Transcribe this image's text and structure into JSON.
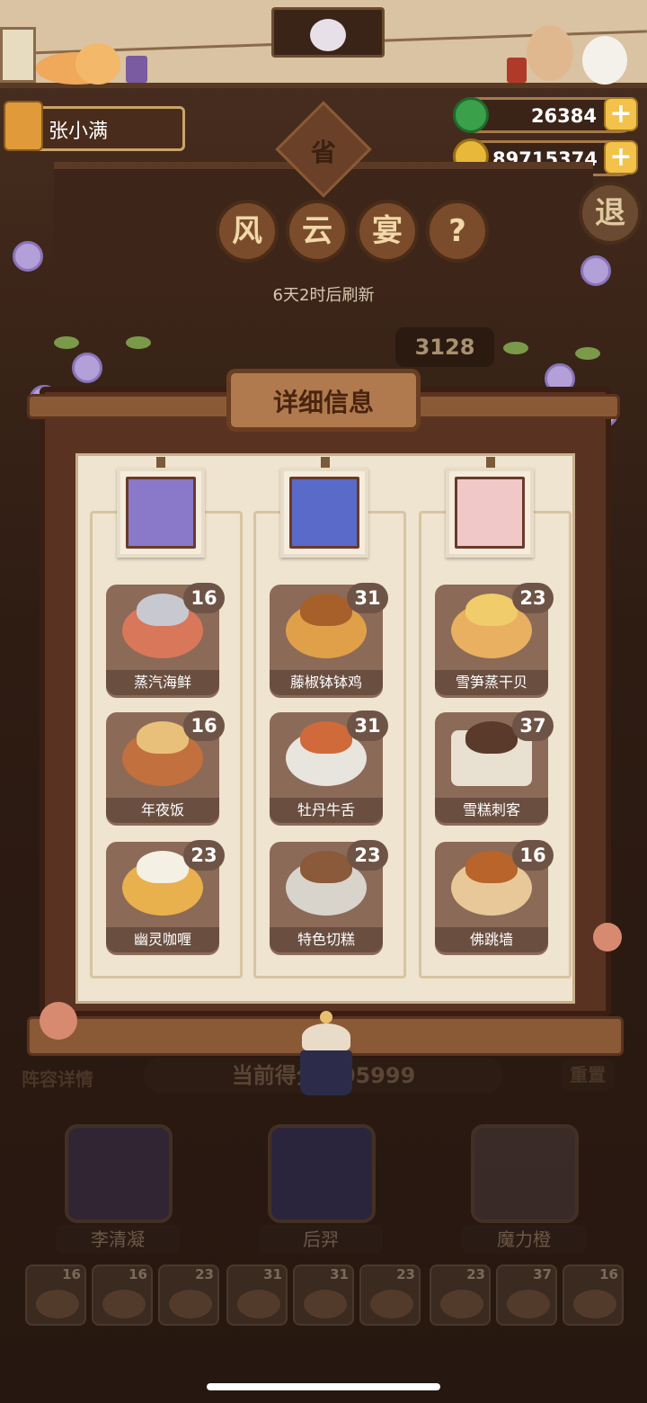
{
  "player": {
    "name": "张小满"
  },
  "currency": {
    "jade": "26384",
    "coins": "89715374"
  },
  "banner": {
    "ornament_char": "省",
    "chars": [
      "风",
      "云",
      "宴"
    ],
    "help_char": "?",
    "exit_char": "退"
  },
  "refresh_text": "6天2时后刷新",
  "score_partial": "3128",
  "modal": {
    "title": "详细信息",
    "columns": [
      {
        "character": "李清凝",
        "dishes": [
          {
            "name": "蒸汽海鲜",
            "count": "16",
            "color": "#d9775a"
          },
          {
            "name": "年夜饭",
            "count": "16",
            "color": "#c2703e"
          },
          {
            "name": "幽灵咖喱",
            "count": "23",
            "color": "#e9b04e"
          }
        ]
      },
      {
        "character": "后羿",
        "dishes": [
          {
            "name": "藤椒钵钵鸡",
            "count": "31",
            "color": "#e0a04a"
          },
          {
            "name": "牡丹牛舌",
            "count": "31",
            "color": "#d06a3a"
          },
          {
            "name": "特色切糕",
            "count": "23",
            "color": "#8a5a3a"
          }
        ]
      },
      {
        "character": "魔力橙",
        "dishes": [
          {
            "name": "雪笋蒸干贝",
            "count": "23",
            "color": "#f0cc6a"
          },
          {
            "name": "雪糕刺客",
            "count": "37",
            "color": "#e8e0d0"
          },
          {
            "name": "佛跳墙",
            "count": "16",
            "color": "#b8642a"
          }
        ]
      }
    ]
  },
  "bottom": {
    "left_label": "阵容详情",
    "score_text": "当前得分 405999",
    "right_label": "重置",
    "heroes": [
      "李清凝",
      "后羿",
      "魔力橙"
    ],
    "mini_counts": [
      "16",
      "16",
      "23",
      "31",
      "31",
      "23",
      "23",
      "37",
      "16"
    ]
  }
}
